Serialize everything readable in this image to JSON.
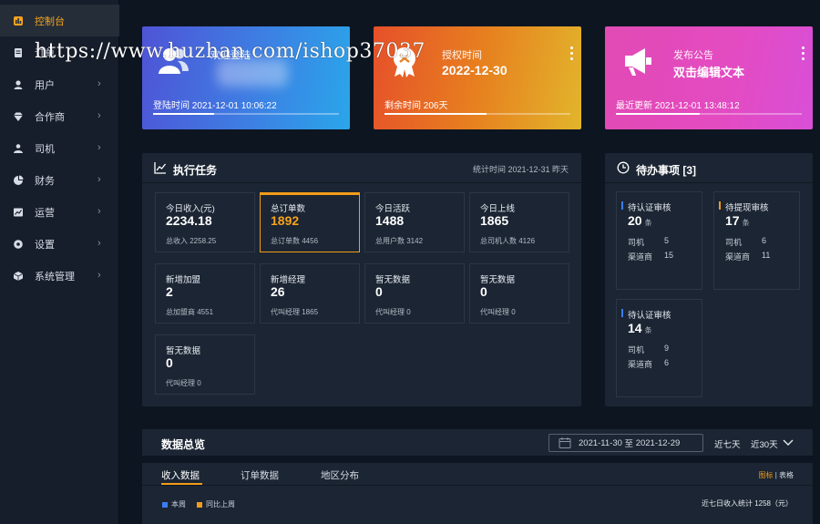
{
  "watermark": "https://www.huzhan.com/ishop37037",
  "sidebar": {
    "items": [
      {
        "label": "控制台",
        "icon": "dashboard-icon"
      },
      {
        "label": "订单",
        "icon": "document-icon"
      },
      {
        "label": "用户",
        "icon": "user-icon"
      },
      {
        "label": "合作商",
        "icon": "diamond-icon"
      },
      {
        "label": "司机",
        "icon": "driver-icon"
      },
      {
        "label": "财务",
        "icon": "pie-chart-icon"
      },
      {
        "label": "运营",
        "icon": "line-chart-icon"
      },
      {
        "label": "设置",
        "icon": "gear-icon"
      },
      {
        "label": "系统管理",
        "icon": "cube-icon"
      }
    ]
  },
  "cards": {
    "login": {
      "title": "欢迎登陆",
      "foot": "登陆时间 2021-12-01 10:06:22",
      "progress": 0.33
    },
    "expire": {
      "small": "授权时间",
      "big": "2022-12-30",
      "foot": "剩余时间 206天",
      "progress": 0.55
    },
    "notice": {
      "small": "发布公告",
      "big": "双击编辑文本",
      "foot": "最近更新 2021-12-01 13:48:12",
      "progress": 0.45
    }
  },
  "tasks": {
    "title": "执行任务",
    "stat_time": "统计时间 2021-12-31 昨天",
    "stats": [
      {
        "label": "今日收入(元)",
        "value": "2234.18",
        "sub": "总收入 2258.25"
      },
      {
        "label": "总订单数",
        "value": "1892",
        "sub": "总订单数 4456"
      },
      {
        "label": "今日活跃",
        "value": "1488",
        "sub": "总用户数 3142"
      },
      {
        "label": "今日上线",
        "value": "1865",
        "sub": "总司机人数 4126"
      },
      {
        "label": "新增加盟",
        "value": "2",
        "sub": "总加盟商 4551"
      },
      {
        "label": "新增经理",
        "value": "26",
        "sub": "代叫经理 1865"
      },
      {
        "label": "暂无数据",
        "value": "0",
        "sub": "代叫经理 0"
      },
      {
        "label": "暂无数据",
        "value": "0",
        "sub": "代叫经理 0"
      },
      {
        "label": "暂无数据",
        "value": "0",
        "sub": "代叫经理 0"
      }
    ]
  },
  "todo": {
    "title": "待办事项",
    "count": "[3]",
    "items": [
      {
        "label": "待认证审核",
        "num": "20",
        "unit": "条",
        "r1k": "司机",
        "r1v": "5",
        "r2k": "渠道商",
        "r2v": "15",
        "color": "#3b7cf6"
      },
      {
        "label": "待提现审核",
        "num": "17",
        "unit": "条",
        "r1k": "司机",
        "r1v": "6",
        "r2k": "渠道商",
        "r2v": "11",
        "color": "#f39c1a"
      },
      {
        "label": "待认证审核",
        "num": "14",
        "unit": "条",
        "r1k": "司机",
        "r1v": "9",
        "r2k": "渠道商",
        "r2v": "6",
        "color": "#3b7cf6"
      }
    ]
  },
  "overview": {
    "title": "数据总览",
    "date_start": "2021-11-30",
    "date_sep": "至",
    "date_end": "2021-12-29",
    "opt_7": "近七天",
    "opt_30": "近30天"
  },
  "tabs": {
    "items": [
      "收入数据",
      "订单数据",
      "地区分布"
    ],
    "view_chart": "图标",
    "view_sep": "|",
    "view_table": "表格",
    "legend_a": "本周",
    "legend_b": "同比上周",
    "summary": "近七日收入统计 1258（元）"
  },
  "colors": {
    "accent": "#f39c1a",
    "blue": "#3b7cf6"
  }
}
